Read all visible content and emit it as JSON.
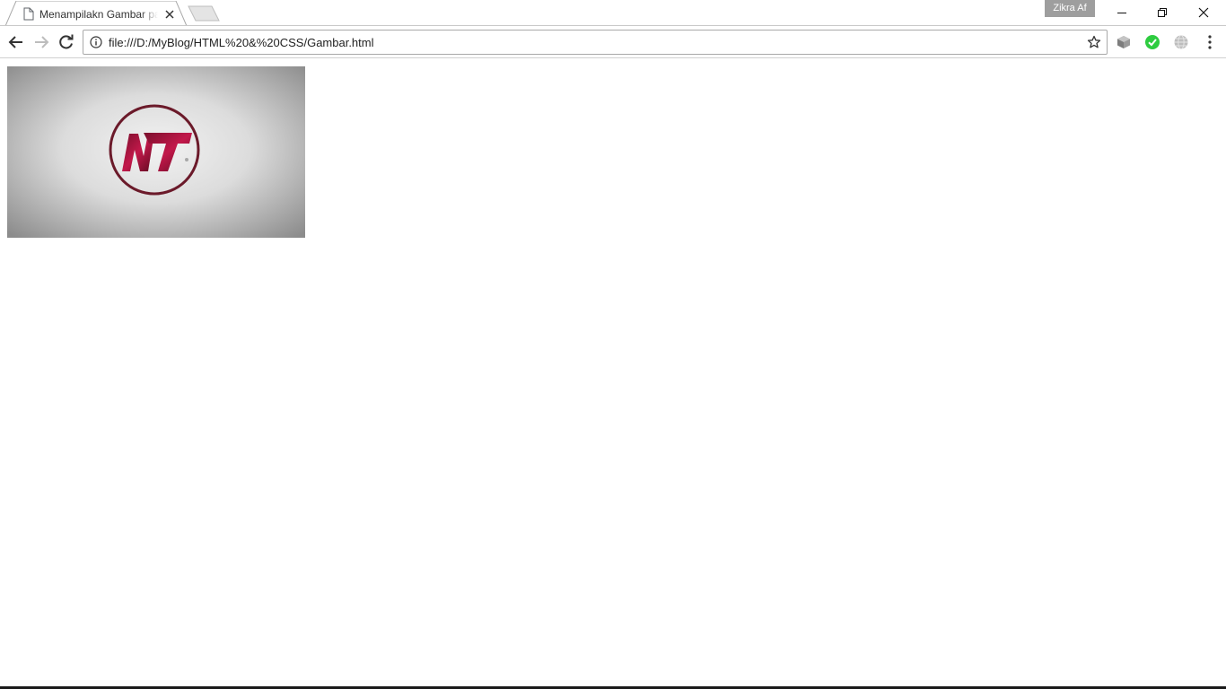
{
  "tab": {
    "title": "Menampilakn Gambar pada HTML",
    "favicon": "page-icon"
  },
  "profile": {
    "name": "Zikra Af"
  },
  "omnibox": {
    "url": "file:///D:/MyBlog/HTML%20&%20CSS/Gambar.html"
  },
  "toolbar": {
    "icons": [
      "back-arrow-icon",
      "forward-arrow-icon",
      "reload-icon",
      "info-icon",
      "bookmark-star-icon"
    ],
    "extensions": [
      "extension-cube-icon",
      "extension-check-icon",
      "extension-globe-icon"
    ],
    "menu": "more-vert-icon"
  },
  "window_controls": [
    "minimize-icon",
    "restore-icon",
    "close-icon"
  ],
  "page": {
    "image": {
      "logo_letters": "NT",
      "accent_color": "#b3123f",
      "ring_color": "#6b1a2a"
    }
  }
}
